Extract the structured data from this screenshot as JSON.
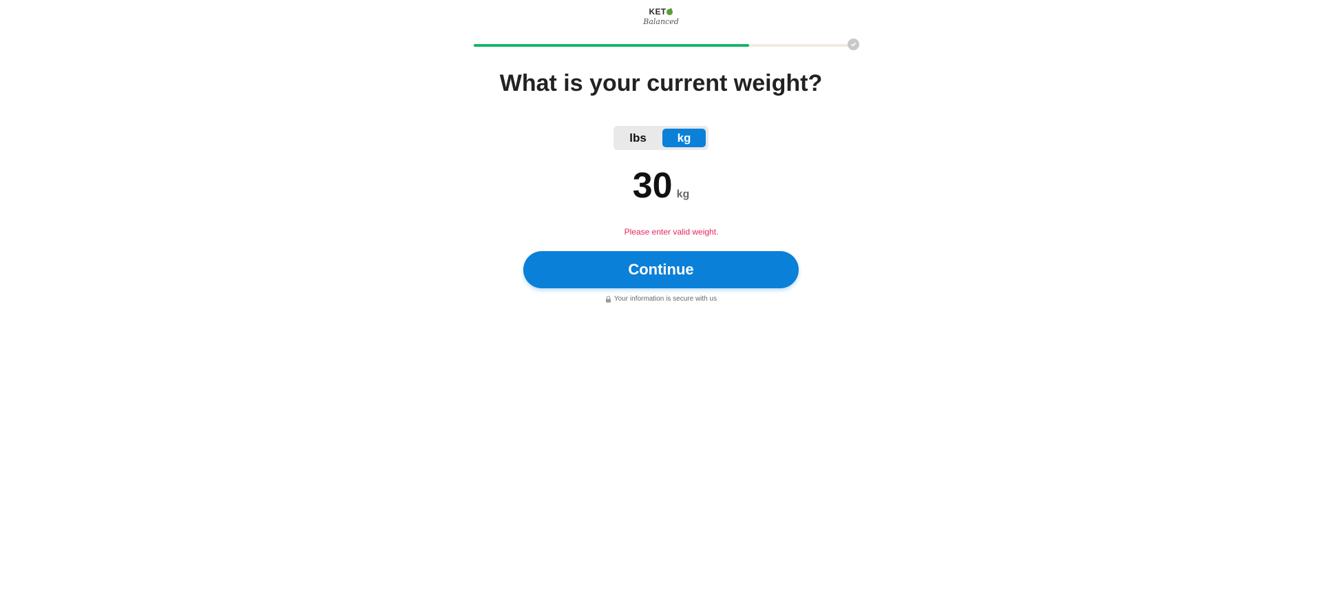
{
  "brand": {
    "logo_top": "KET",
    "logo_bottom": "Balanced",
    "leaf_color": "#5b9f3a"
  },
  "progress": {
    "fraction": 0.715,
    "fill_color": "#17b36b",
    "track_color": "#f1ebe1",
    "end_icon": "check-icon"
  },
  "question": {
    "title": "What is your current weight?"
  },
  "units": {
    "options": [
      "lbs",
      "kg"
    ],
    "selected": "kg",
    "accent_color": "#0a80d8"
  },
  "weight": {
    "value": "30",
    "unit": "kg"
  },
  "error": {
    "message": "Please enter valid weight.",
    "color": "#e8245b"
  },
  "actions": {
    "continue_label": "Continue"
  },
  "footer": {
    "secure_note": "Your information is secure with us",
    "icon": "lock-icon"
  }
}
